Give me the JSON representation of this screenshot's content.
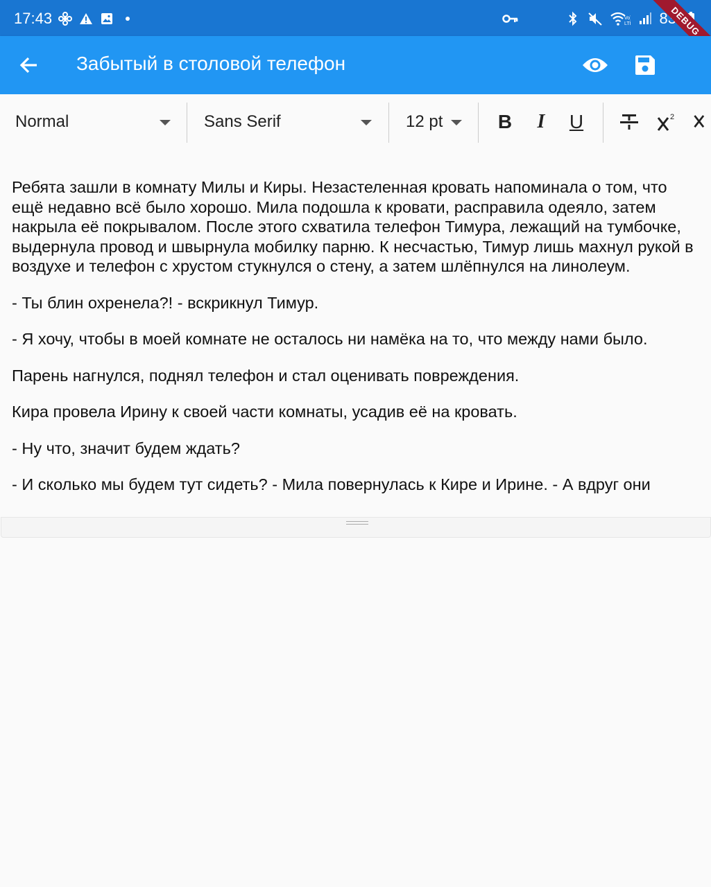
{
  "status": {
    "time": "17:43",
    "battery": "83"
  },
  "debug_banner": "DEBUG",
  "appbar": {
    "title": "Забытый в столовой телефон"
  },
  "toolbar": {
    "style_value": "Normal",
    "font_value": "Sans Serif",
    "size_value": "12 pt",
    "bold_label": "B",
    "italic_label": "I",
    "underline_label": "U"
  },
  "document": {
    "paragraphs": [
      "Ребята зашли в комнату Милы и Киры. Незастеленная кровать напоминала о том, что ещё недавно всё было хорошо. Мила подошла к кровати, расправила одеяло, затем накрыла её покрывалом. После этого схватила телефон Тимура, лежащий на тумбочке, выдернула провод и швырнула мобилку парню. К несчастью, Тимур лишь махнул рукой в воздухе и телефон с хрустом стукнулся о стену, а затем шлёпнулся на линолеум.",
      "- Ты блин охренела?! - вскрикнул Тимур.",
      "- Я хочу, чтобы в моей комнате не осталось ни намёка на то, что между нами было.",
      "Парень нагнулся, поднял телефон и стал оценивать повреждения.",
      "Кира провела Ирину к своей части комнаты, усадив её на кровать.",
      "- Ну что, значит будем ждать?",
      "- И сколько мы будем тут сидеть? - Мила повернулась к Кире и Ирине. - А вдруг они"
    ]
  }
}
